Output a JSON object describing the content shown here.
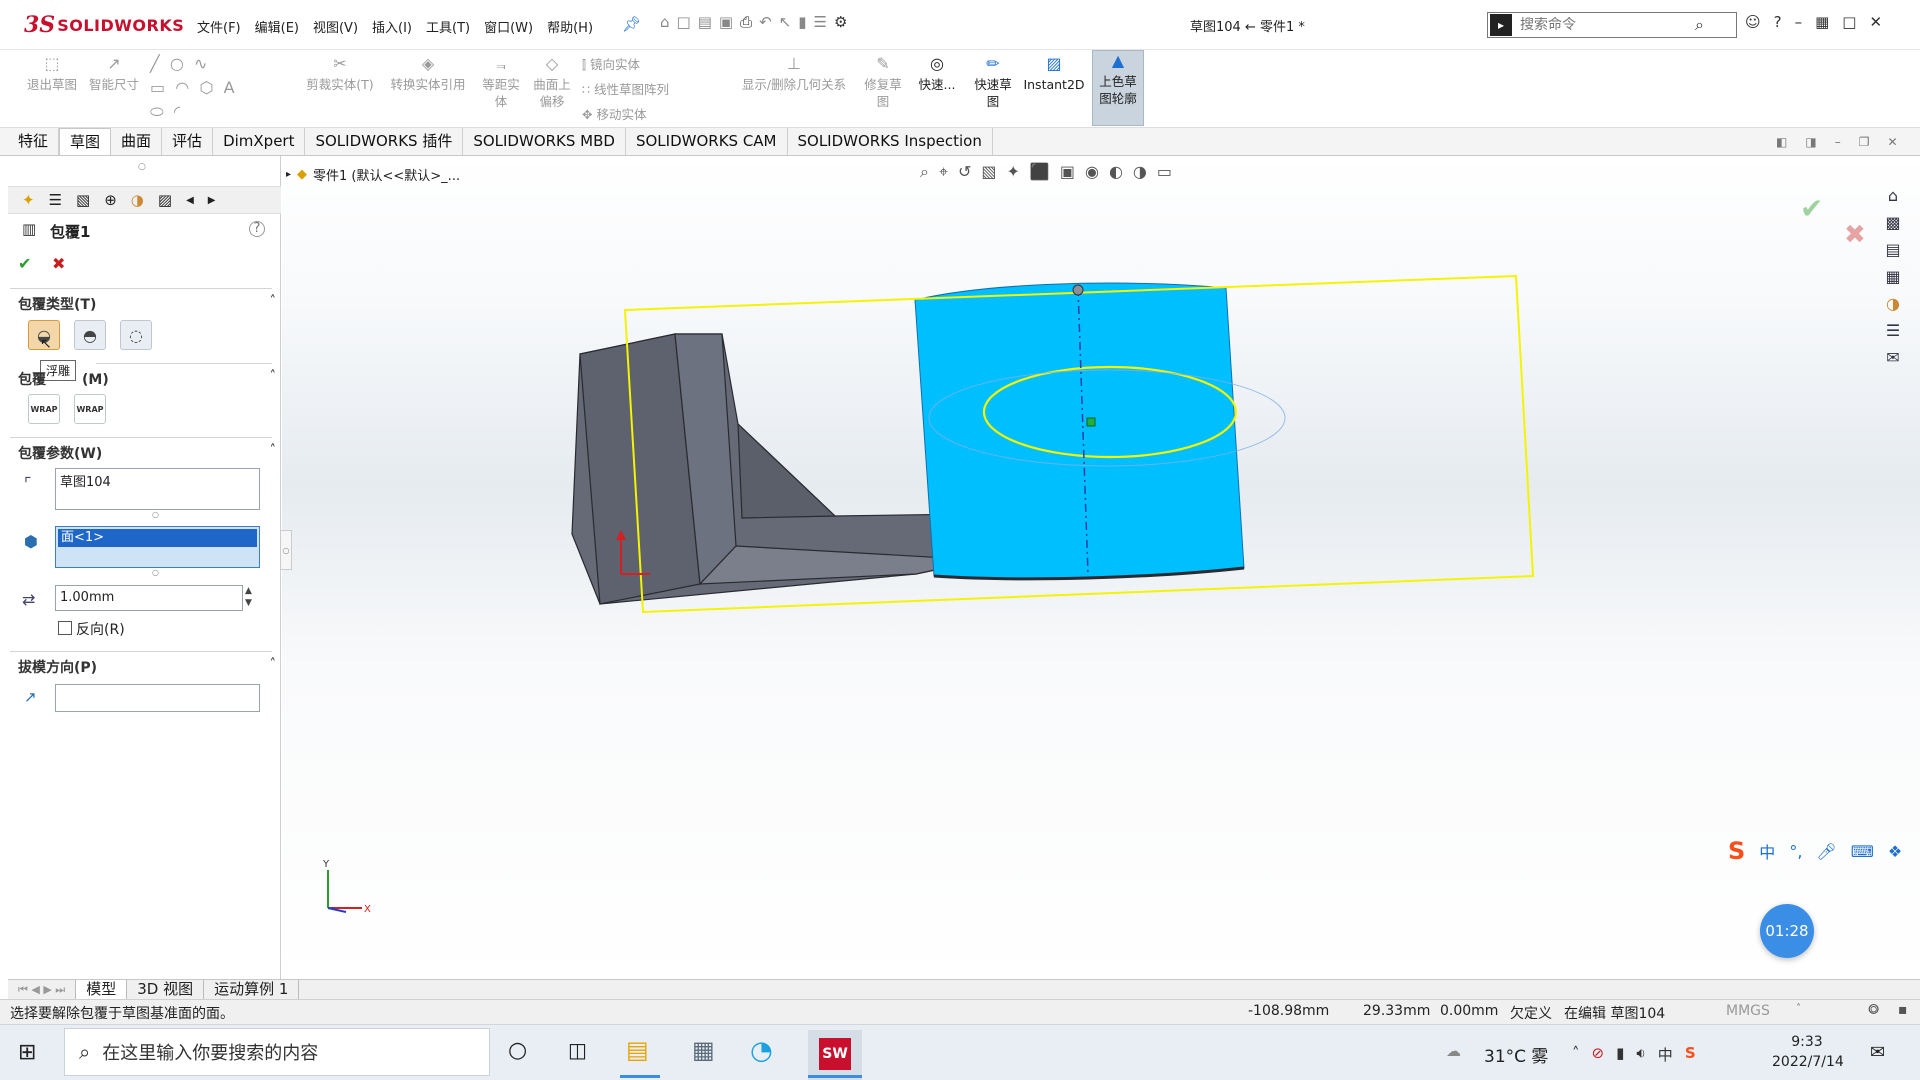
{
  "app": {
    "brand_prefix": "3S",
    "brand": "SOLIDWORKS"
  },
  "menubar": {
    "items": [
      "文件(F)",
      "编辑(E)",
      "视图(V)",
      "插入(I)",
      "工具(T)",
      "窗口(W)",
      "帮助(H)"
    ]
  },
  "title": "草图104 ← 零件1 *",
  "search": {
    "placeholder": "搜索命令"
  },
  "ribbon": {
    "exit_sketch": "退出草图",
    "smart_dim": "智能尺寸",
    "trim": "剪裁实体(T)",
    "convert": "转换实体引用",
    "offset": "等距实体",
    "surface_offset": "曲面上偏移",
    "mirror": "镜向实体",
    "linear_pattern": "线性草图阵列",
    "move": "移动实体",
    "show_relations": "显示/删除几何关系",
    "repair": "修复草图",
    "quick_snaps": "快速...",
    "rapid_sketch": "快速草图",
    "instant2d": "Instant2D",
    "shaded_contours": "上色草图轮廓"
  },
  "tabs": [
    "特征",
    "草图",
    "曲面",
    "评估",
    "DimXpert",
    "SOLIDWORKS 插件",
    "SOLIDWORKS MBD",
    "SOLIDWORKS CAM",
    "SOLIDWORKS Inspection"
  ],
  "tabs_selected": 1,
  "feature_tree": {
    "breadcrumb": "零件1 (默认<<默认>_..."
  },
  "panel": {
    "title": "包覆1",
    "wrap_type": "包覆类型(T)",
    "tooltip": "浮雕",
    "wrap_method_a": "包覆",
    "wrap_method_b": "(M)",
    "wrap_params": "包覆参数(W)",
    "sketch_value": "草图104",
    "face_value": "面<1>",
    "thickness": "1.00mm",
    "reverse": "反向(R)",
    "draft": "拔模方向(P)",
    "wrap_icon_text": "WRAP"
  },
  "axes": {
    "y": "Y",
    "x": "X"
  },
  "bottom_tabs": [
    "模型",
    "3D 视图",
    "运动算例 1"
  ],
  "status": {
    "message": "选择要解除包覆于草图基准面的面。",
    "x": "-108.98mm",
    "y": "29.33mm",
    "z": "0.00mm",
    "state": "欠定义",
    "editing": "在编辑 草图104",
    "units": "MMGS"
  },
  "timer": "01:28",
  "ime": {
    "lang": "中"
  },
  "taskbar": {
    "search_placeholder": "在这里输入你要搜索的内容",
    "weather": "31°C 雾",
    "time": "9:33",
    "date": "2022/7/14",
    "input_lang": "中"
  },
  "colors": {
    "cylinder": "#00bfff",
    "sketch": "#f4f400",
    "body": "#5f6470",
    "brand": "#c8102e"
  }
}
